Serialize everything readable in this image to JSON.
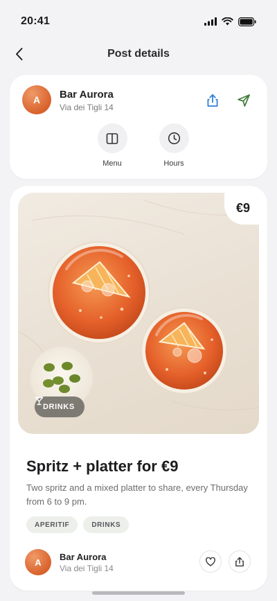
{
  "status_bar": {
    "time": "20:41"
  },
  "nav": {
    "title": "Post details"
  },
  "venue": {
    "avatar_letter": "A",
    "name": "Bar Aurora",
    "address": "Via dei Tigli 14",
    "actions": {
      "menu_label": "Menu",
      "hours_label": "Hours"
    }
  },
  "post": {
    "price_badge": "€9",
    "category_chip": "DRINKS",
    "title": "Spritz + platter for €9",
    "description": "Two spritz and a mixed platter to share, every Thursday from 6 to 9 pm.",
    "tags": [
      "APERITIF",
      "DRINKS"
    ],
    "author": {
      "avatar_letter": "A",
      "name": "Bar Aurora",
      "address": "Via dei Tigli 14"
    }
  },
  "colors": {
    "accent_blue": "#2f7fd8",
    "accent_green": "#3f7a3a",
    "avatar_orange": "#e0723b"
  },
  "icons": {
    "back": "chevron-left-icon",
    "share": "share-icon",
    "navigate": "navigate-arrow-icon",
    "menu": "book-open-icon",
    "hours": "clock-icon",
    "drinks": "cocktail-glass-icon",
    "like": "heart-icon"
  }
}
